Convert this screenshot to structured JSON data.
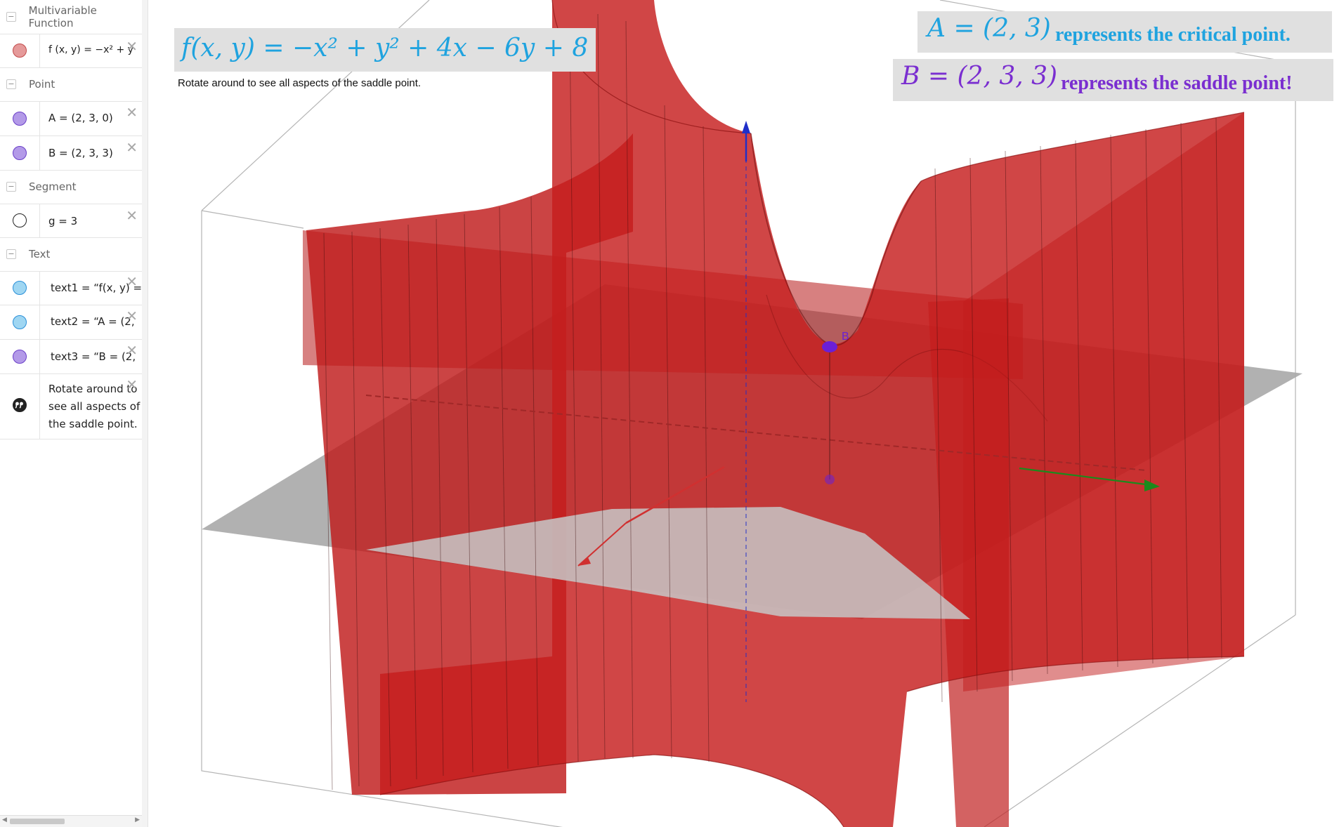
{
  "sidebar": {
    "groups": [
      {
        "header": "Multivariable Function",
        "items": [
          {
            "text": "f (x, y) = −x² + y",
            "marble_color": "#e06666",
            "marble_fill": "#e59a9a"
          }
        ]
      },
      {
        "header": "Point",
        "items": [
          {
            "text": "A = (2, 3, 0)",
            "marble_color": "#6a3fc8",
            "marble_fill": "#b39ae8"
          },
          {
            "text": "B = (2, 3, 3)",
            "marble_color": "#6a3fc8",
            "marble_fill": "#b39ae8"
          }
        ]
      },
      {
        "header": "Segment",
        "items": [
          {
            "text": "g = 3",
            "marble_color": "#222222",
            "marble_fill": "#ffffff"
          }
        ]
      },
      {
        "header": "Text",
        "items": [
          {
            "text": "text1 = “f(x, y) =",
            "marble_color": "#2a8fd8",
            "marble_fill": "#9fd6f2"
          },
          {
            "text": "text2 = “A = (2,",
            "marble_color": "#2a8fd8",
            "marble_fill": "#9fd6f2"
          },
          {
            "text": "text3 = “B = (2,",
            "marble_color": "#6a3fc8",
            "marble_fill": "#b39ae8"
          },
          {
            "lines": [
              "Rotate around to",
              "see all aspects of",
              "the saddle point."
            ],
            "marble_icon": "quote-icon"
          }
        ]
      }
    ],
    "close_glyph": "✕",
    "toggle_glyph": "−"
  },
  "graphics": {
    "text1": "f(x, y) = −x² + y² + 4x − 6y + 8",
    "text2_formula": "A = (2, 3)",
    "text2_caption": "represents the critical point.",
    "text3_formula": "B = (2, 3, 3)",
    "text3_caption": "represents the saddle point!",
    "text4": "Rotate around to see all aspects of the saddle point.",
    "point_b_label": "B",
    "surface_color": "#c41a1a",
    "plane_color": "#9a9a9a",
    "x_axis_color": "#b53030",
    "y_axis_color": "#1c8a1c",
    "z_axis_color": "#2633c7",
    "point_color": "#6a1fd6"
  }
}
